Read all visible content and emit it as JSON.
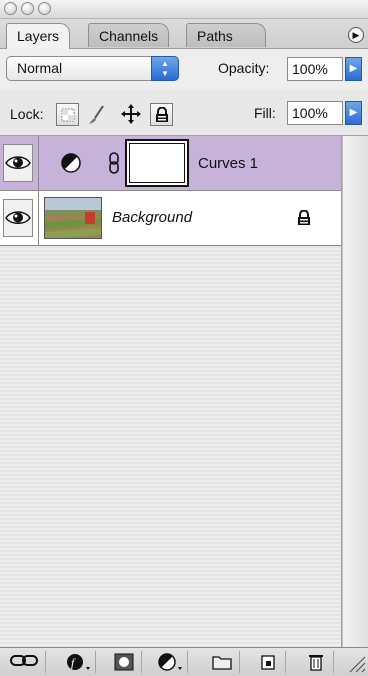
{
  "tabs": [
    {
      "label": "Layers",
      "active": true
    },
    {
      "label": "Channels",
      "active": false
    },
    {
      "label": "Paths",
      "active": false
    }
  ],
  "blend_mode": "Normal",
  "opacity": {
    "label": "Opacity:",
    "value": "100%"
  },
  "lock_label": "Lock:",
  "fill": {
    "label": "Fill:",
    "value": "100%"
  },
  "lock_icons": [
    "lock-transparent-pixels-icon",
    "lock-image-pixels-icon",
    "lock-position-icon",
    "lock-all-icon"
  ],
  "layers": [
    {
      "name": "Curves 1",
      "selected": true,
      "visible": true,
      "type": "adjustment-curves"
    },
    {
      "name": "Background",
      "selected": false,
      "visible": true,
      "locked": true,
      "type": "image"
    }
  ],
  "bottom_buttons": [
    "link-layers-icon",
    "layer-style-icon",
    "layer-mask-icon",
    "adjustment-layer-icon",
    "new-group-icon",
    "new-layer-icon",
    "trash-icon"
  ],
  "colors": {
    "selected_layer": "#c7b2da",
    "accent_blue": "#2a6cd2"
  }
}
